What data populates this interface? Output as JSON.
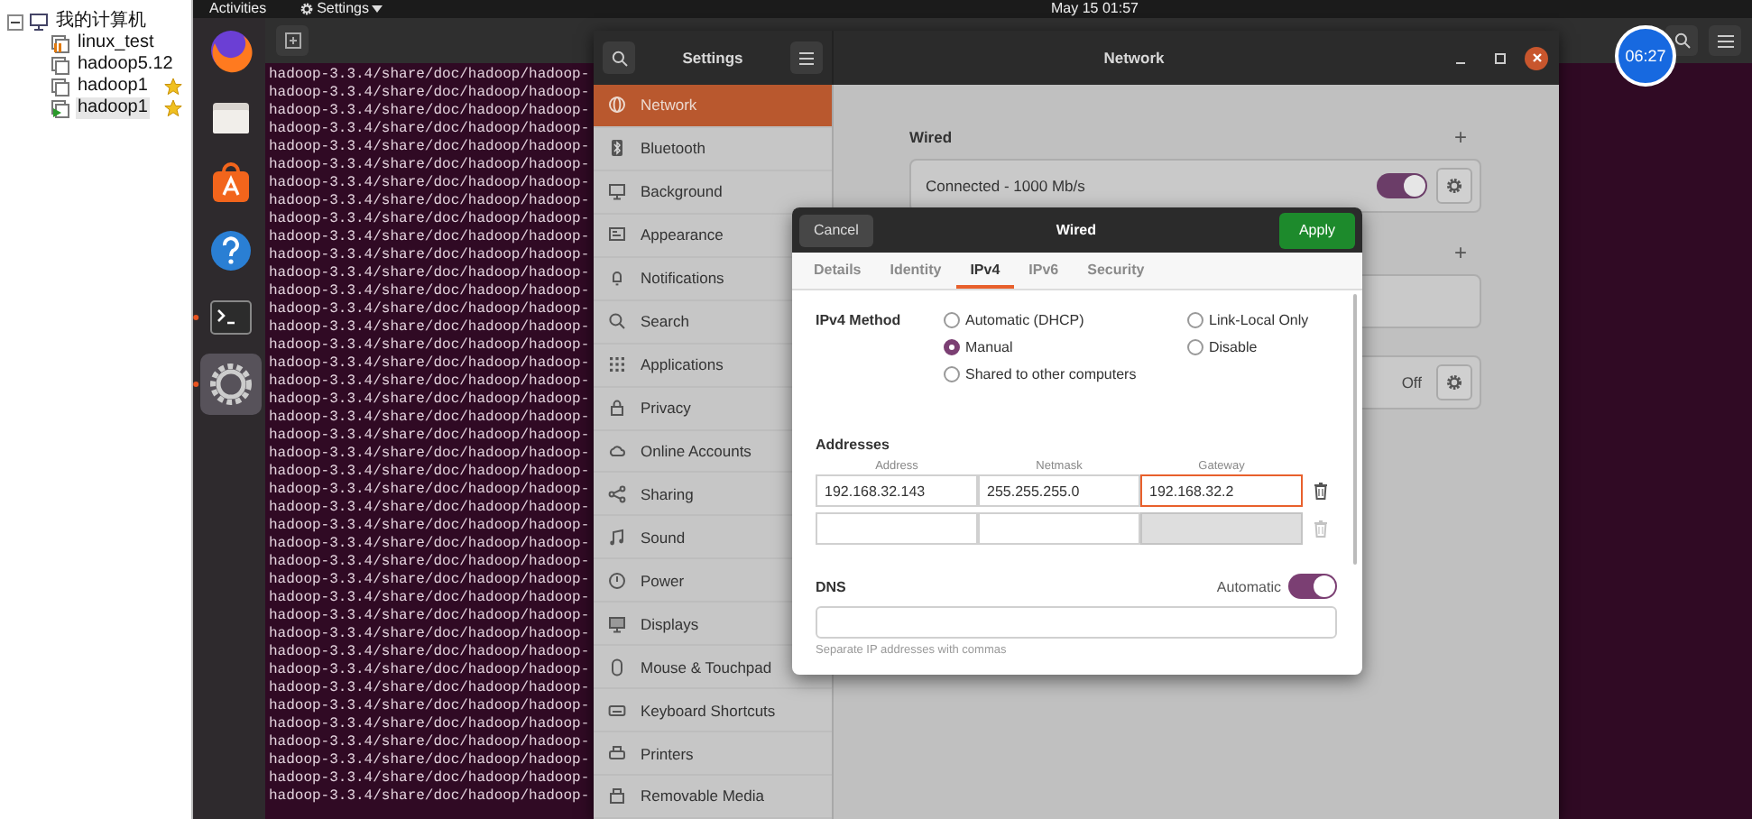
{
  "library": {
    "root": {
      "label": "我的计算机",
      "expanded": true,
      "children": [
        {
          "label": "linux_test",
          "kind": "suspended",
          "favorite": false,
          "selected": false
        },
        {
          "label": "hadoop5.12",
          "kind": "off",
          "favorite": false,
          "selected": false
        },
        {
          "label": "hadoop1",
          "kind": "off",
          "favorite": true,
          "selected": false
        },
        {
          "label": "hadoop1",
          "kind": "running",
          "favorite": true,
          "selected": true
        }
      ]
    }
  },
  "top_bar": {
    "activities": "Activities",
    "app_menu": "Settings",
    "clock": "May 15 01:57"
  },
  "dock": [
    {
      "running": false,
      "selected": false
    },
    {
      "running": false,
      "selected": false
    },
    {
      "running": false,
      "selected": false
    },
    {
      "running": false,
      "selected": false
    },
    {
      "running": true,
      "selected": false
    },
    {
      "running": true,
      "selected": true
    }
  ],
  "terminal": {
    "lines": [
      "hadoop-3.3.4/share/doc/hadoop/hadoop-",
      "hadoop-3.3.4/share/doc/hadoop/hadoop-",
      "hadoop-3.3.4/share/doc/hadoop/hadoop-",
      "hadoop-3.3.4/share/doc/hadoop/hadoop-",
      "hadoop-3.3.4/share/doc/hadoop/hadoop-",
      "hadoop-3.3.4/share/doc/hadoop/hadoop-",
      "hadoop-3.3.4/share/doc/hadoop/hadoop-",
      "hadoop-3.3.4/share/doc/hadoop/hadoop-",
      "hadoop-3.3.4/share/doc/hadoop/hadoop-",
      "hadoop-3.3.4/share/doc/hadoop/hadoop-",
      "hadoop-3.3.4/share/doc/hadoop/hadoop-",
      "hadoop-3.3.4/share/doc/hadoop/hadoop-",
      "hadoop-3.3.4/share/doc/hadoop/hadoop-",
      "hadoop-3.3.4/share/doc/hadoop/hadoop-",
      "hadoop-3.3.4/share/doc/hadoop/hadoop-",
      "hadoop-3.3.4/share/doc/hadoop/hadoop-",
      "hadoop-3.3.4/share/doc/hadoop/hadoop-",
      "hadoop-3.3.4/share/doc/hadoop/hadoop-",
      "hadoop-3.3.4/share/doc/hadoop/hadoop-",
      "hadoop-3.3.4/share/doc/hadoop/hadoop-",
      "hadoop-3.3.4/share/doc/hadoop/hadoop-",
      "hadoop-3.3.4/share/doc/hadoop/hadoop-",
      "hadoop-3.3.4/share/doc/hadoop/hadoop-",
      "hadoop-3.3.4/share/doc/hadoop/hadoop-",
      "hadoop-3.3.4/share/doc/hadoop/hadoop-",
      "hadoop-3.3.4/share/doc/hadoop/hadoop-",
      "hadoop-3.3.4/share/doc/hadoop/hadoop-",
      "hadoop-3.3.4/share/doc/hadoop/hadoop-",
      "hadoop-3.3.4/share/doc/hadoop/hadoop-",
      "hadoop-3.3.4/share/doc/hadoop/hadoop-",
      "hadoop-3.3.4/share/doc/hadoop/hadoop-",
      "hadoop-3.3.4/share/doc/hadoop/hadoop-",
      "hadoop-3.3.4/share/doc/hadoop/hadoop-",
      "hadoop-3.3.4/share/doc/hadoop/hadoop-",
      "hadoop-3.3.4/share/doc/hadoop/hadoop-",
      "hadoop-3.3.4/share/doc/hadoop/hadoop-",
      "hadoop-3.3.4/share/doc/hadoop/hadoop-",
      "hadoop-3.3.4/share/doc/hadoop/hadoop-",
      "hadoop-3.3.4/share/doc/hadoop/hadoop-",
      "hadoop-3.3.4/share/doc/hadoop/hadoop-",
      "hadoop-3.3.4/share/doc/hadoop/hadoop-"
    ]
  },
  "settings": {
    "title": "Settings",
    "panel_title": "Network",
    "sidebar": [
      {
        "label": "Network",
        "selected": true
      },
      {
        "label": "Bluetooth",
        "selected": false
      },
      {
        "label": "Background",
        "selected": false
      },
      {
        "label": "Appearance",
        "selected": false
      },
      {
        "label": "Notifications",
        "selected": false
      },
      {
        "label": "Search",
        "selected": false
      },
      {
        "label": "Applications",
        "selected": false
      },
      {
        "label": "Privacy",
        "selected": false
      },
      {
        "label": "Online Accounts",
        "selected": false
      },
      {
        "label": "Sharing",
        "selected": false
      },
      {
        "label": "Sound",
        "selected": false
      },
      {
        "label": "Power",
        "selected": false
      },
      {
        "label": "Displays",
        "selected": false
      },
      {
        "label": "Mouse & Touchpad",
        "selected": false
      },
      {
        "label": "Keyboard Shortcuts",
        "selected": false
      },
      {
        "label": "Printers",
        "selected": false
      },
      {
        "label": "Removable Media",
        "selected": false
      }
    ],
    "sections": [
      {
        "title": "Wired",
        "add": "+",
        "rows": [
          {
            "kind": "toggle",
            "label": "Connected - 1000 Mb/s",
            "on": true
          }
        ]
      },
      {
        "add": "+",
        "rows": [
          {
            "kind": "blank"
          }
        ]
      },
      {
        "rows": [
          {
            "kind": "status",
            "status": "Off"
          }
        ]
      }
    ]
  },
  "dialog": {
    "title": "Wired",
    "cancel": "Cancel",
    "apply": "Apply",
    "tabs": [
      {
        "label": "Details",
        "selected": false
      },
      {
        "label": "Identity",
        "selected": false
      },
      {
        "label": "IPv4",
        "selected": true
      },
      {
        "label": "IPv6",
        "selected": false
      },
      {
        "label": "Security",
        "selected": false
      }
    ],
    "method_label": "IPv4 Method",
    "methods": [
      {
        "label": "Automatic (DHCP)",
        "selected": false
      },
      {
        "label": "Manual",
        "selected": true
      },
      {
        "label": "Shared to other computers",
        "selected": false
      },
      {
        "label": "Link-Local Only",
        "selected": false
      },
      {
        "label": "Disable",
        "selected": false
      }
    ],
    "addresses": {
      "title": "Addresses",
      "columns": [
        "Address",
        "Netmask",
        "Gateway"
      ],
      "rows": [
        {
          "cells": [
            {
              "value": "192.168.32.143",
              "focused": false,
              "disabled": false
            },
            {
              "value": "255.255.255.0",
              "focused": false,
              "disabled": false
            },
            {
              "value": "192.168.32.2",
              "focused": true,
              "disabled": false
            }
          ],
          "delete_disabled": false
        },
        {
          "cells": [
            {
              "focused": false,
              "disabled": false
            },
            {
              "focused": false,
              "disabled": false
            },
            {
              "focused": false,
              "disabled": true
            }
          ],
          "delete_disabled": true
        }
      ]
    },
    "dns": {
      "title": "DNS",
      "auto_label": "Automatic",
      "auto": true,
      "hint": "Separate IP addresses with commas"
    }
  },
  "recorder": {
    "time": "06:27"
  }
}
